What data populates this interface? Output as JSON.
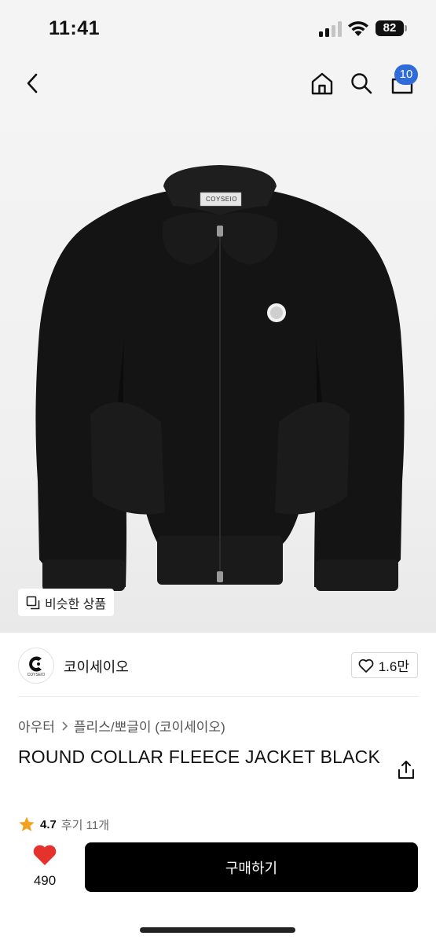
{
  "status_bar": {
    "time": "11:41",
    "battery": "82"
  },
  "header": {
    "cart_count": "10"
  },
  "hero": {
    "similar_label": "비슷한 상품",
    "jacket_tag_text": "COYSEIO"
  },
  "brand": {
    "name": "코이세이오",
    "logo_text": "COYSEIO",
    "likes": "1.6만"
  },
  "product": {
    "category_1": "아우터",
    "category_2": "플리스/뽀글이 (코이세이오)",
    "title": "ROUND COLLAR FLEECE JACKET BLACK",
    "rating": "4.7",
    "review_label": "후기 11개"
  },
  "action_bar": {
    "wish_count": "490",
    "buy_label": "구매하기"
  },
  "colors": {
    "accent": "#2f6bd9",
    "heart": "#e5322d",
    "star": "#f3a01c",
    "buy": "#000000"
  }
}
